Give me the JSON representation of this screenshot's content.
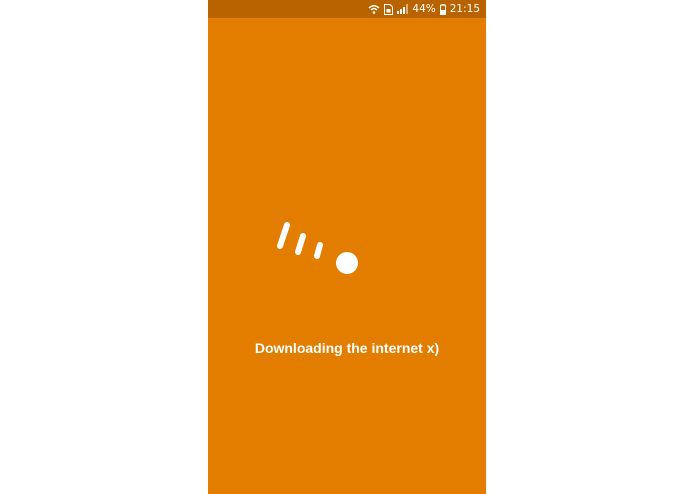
{
  "status_bar": {
    "battery_percent": "44%",
    "time": "21:15"
  },
  "splash": {
    "loading_message": "Downloading the internet x)"
  },
  "colors": {
    "background": "#e27d00",
    "status_bar": "#b86300",
    "foreground": "#ffffff"
  }
}
